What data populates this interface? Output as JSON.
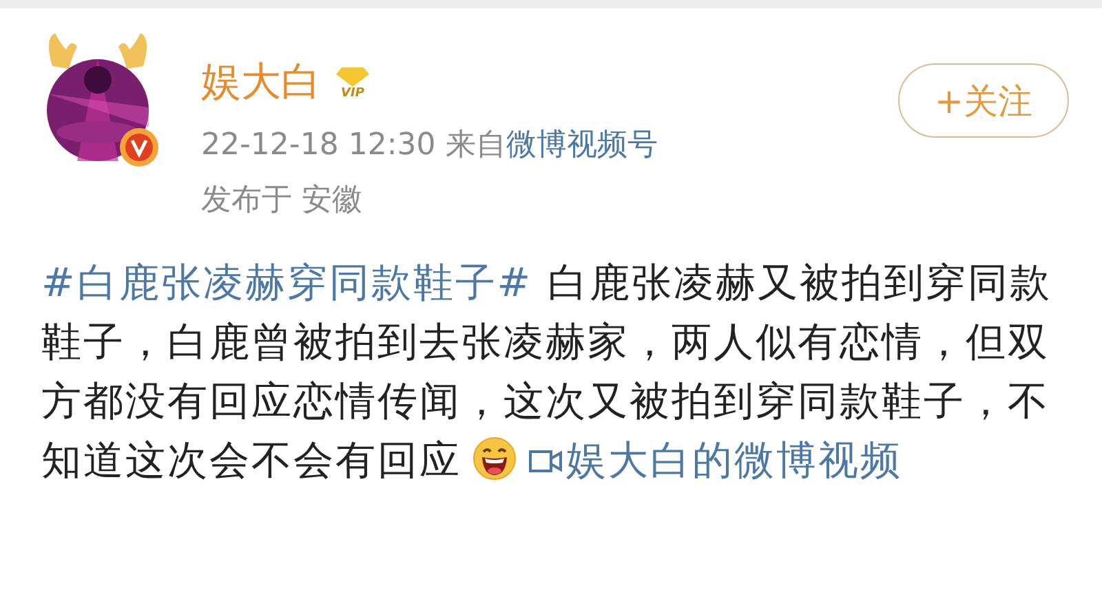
{
  "post": {
    "author": {
      "name": "娱大白",
      "vip_label": "VIP",
      "verified": true
    },
    "follow_button": {
      "label": "+关注"
    },
    "time": "22-12-18 12:30",
    "source_prefix": "来自",
    "source": "微博视频号",
    "location": "发布于 安徽",
    "body": [
      {
        "kind": "hashtag",
        "text": "#白鹿张凌赫穿同款鞋子#"
      },
      {
        "kind": "text",
        "text": " 白鹿张凌赫又被拍到穿同款鞋子，白鹿曾被拍到去张凌赫家，两人似有恋情，但双方都没有回应恋情传闻，这次又被拍到穿同款鞋子，不知道这次会不会有回应"
      },
      {
        "kind": "emoji"
      },
      {
        "kind": "video_link",
        "text": "娱大白的微博视频"
      }
    ]
  }
}
